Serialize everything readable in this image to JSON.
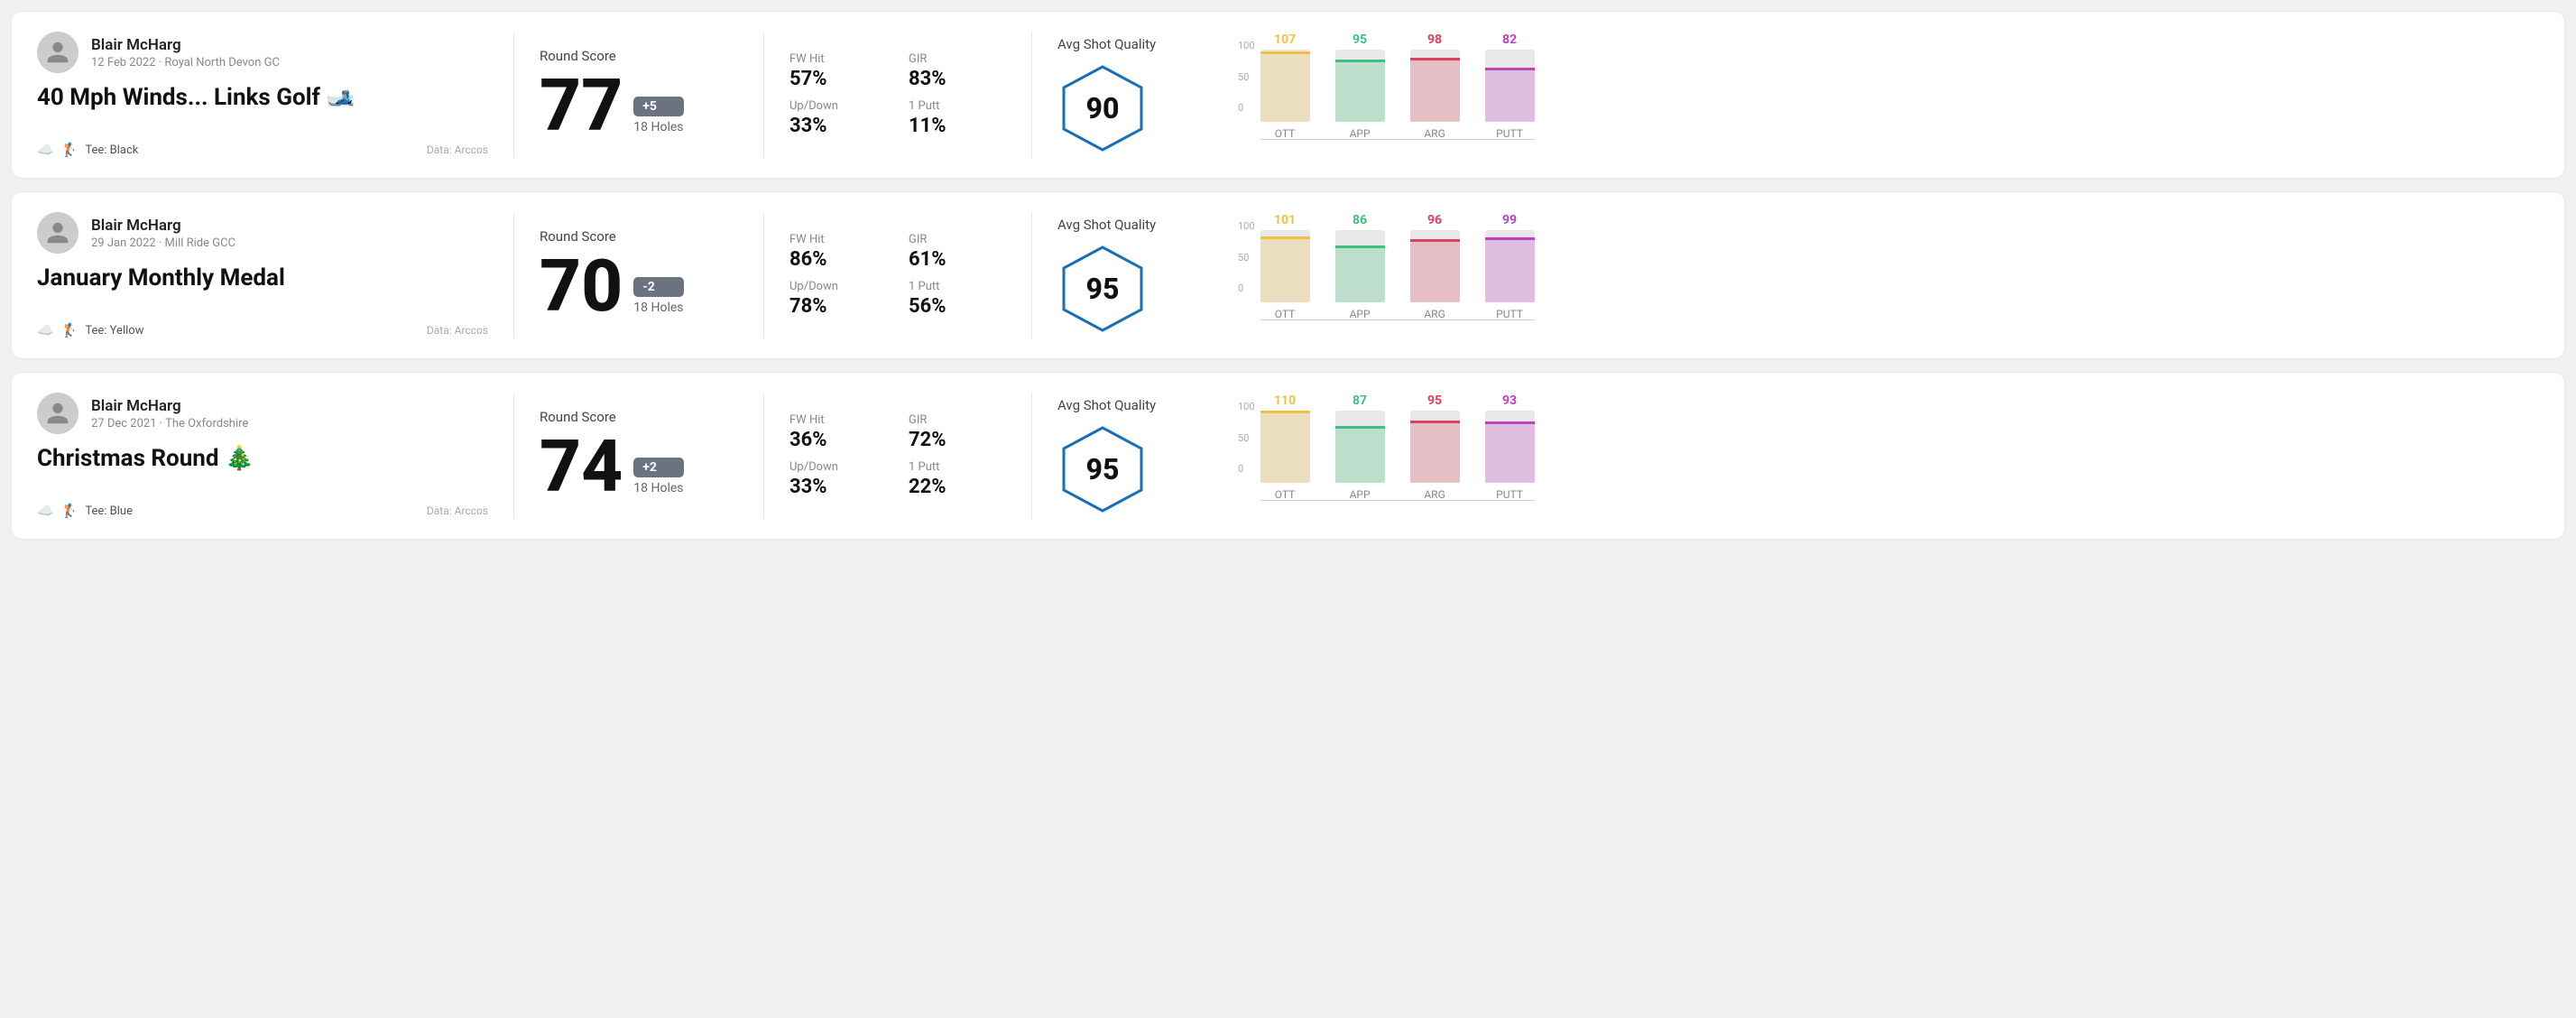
{
  "rounds": [
    {
      "id": "round-1",
      "user": {
        "name": "Blair McHarg",
        "date": "12 Feb 2022 · Royal North Devon GC"
      },
      "title": "40 Mph Winds... Links Golf 🎿",
      "tee": "Black",
      "data_source": "Data: Arccos",
      "score": {
        "label": "Round Score",
        "number": "77",
        "badge": "+5",
        "badge_type": "positive",
        "holes": "18 Holes"
      },
      "stats": {
        "fw_hit_label": "FW Hit",
        "fw_hit_value": "57%",
        "gir_label": "GIR",
        "gir_value": "83%",
        "updown_label": "Up/Down",
        "updown_value": "33%",
        "oneputt_label": "1 Putt",
        "oneputt_value": "11%"
      },
      "shot_quality": {
        "label": "Avg Shot Quality",
        "score": "90"
      },
      "chart": {
        "bars": [
          {
            "label": "OTT",
            "value": 107,
            "color": "#f0c040"
          },
          {
            "label": "APP",
            "value": 95,
            "color": "#40c080"
          },
          {
            "label": "ARG",
            "value": 98,
            "color": "#e04060"
          },
          {
            "label": "PUTT",
            "value": 82,
            "color": "#c040c0"
          }
        ],
        "max": 110,
        "y_labels": [
          "100",
          "50",
          "0"
        ]
      }
    },
    {
      "id": "round-2",
      "user": {
        "name": "Blair McHarg",
        "date": "29 Jan 2022 · Mill Ride GCC"
      },
      "title": "January Monthly Medal",
      "tee": "Yellow",
      "data_source": "Data: Arccos",
      "score": {
        "label": "Round Score",
        "number": "70",
        "badge": "-2",
        "badge_type": "negative",
        "holes": "18 Holes"
      },
      "stats": {
        "fw_hit_label": "FW Hit",
        "fw_hit_value": "86%",
        "gir_label": "GIR",
        "gir_value": "61%",
        "updown_label": "Up/Down",
        "updown_value": "78%",
        "oneputt_label": "1 Putt",
        "oneputt_value": "56%"
      },
      "shot_quality": {
        "label": "Avg Shot Quality",
        "score": "95"
      },
      "chart": {
        "bars": [
          {
            "label": "OTT",
            "value": 101,
            "color": "#f0c040"
          },
          {
            "label": "APP",
            "value": 86,
            "color": "#40c080"
          },
          {
            "label": "ARG",
            "value": 96,
            "color": "#e04060"
          },
          {
            "label": "PUTT",
            "value": 99,
            "color": "#c040c0"
          }
        ],
        "max": 110,
        "y_labels": [
          "100",
          "50",
          "0"
        ]
      }
    },
    {
      "id": "round-3",
      "user": {
        "name": "Blair McHarg",
        "date": "27 Dec 2021 · The Oxfordshire"
      },
      "title": "Christmas Round 🎄",
      "tee": "Blue",
      "data_source": "Data: Arccos",
      "score": {
        "label": "Round Score",
        "number": "74",
        "badge": "+2",
        "badge_type": "positive",
        "holes": "18 Holes"
      },
      "stats": {
        "fw_hit_label": "FW Hit",
        "fw_hit_value": "36%",
        "gir_label": "GIR",
        "gir_value": "72%",
        "updown_label": "Up/Down",
        "updown_value": "33%",
        "oneputt_label": "1 Putt",
        "oneputt_value": "22%"
      },
      "shot_quality": {
        "label": "Avg Shot Quality",
        "score": "95"
      },
      "chart": {
        "bars": [
          {
            "label": "OTT",
            "value": 110,
            "color": "#f0c040"
          },
          {
            "label": "APP",
            "value": 87,
            "color": "#40c080"
          },
          {
            "label": "ARG",
            "value": 95,
            "color": "#e04060"
          },
          {
            "label": "PUTT",
            "value": 93,
            "color": "#c040c0"
          }
        ],
        "max": 110,
        "y_labels": [
          "100",
          "50",
          "0"
        ]
      }
    }
  ]
}
